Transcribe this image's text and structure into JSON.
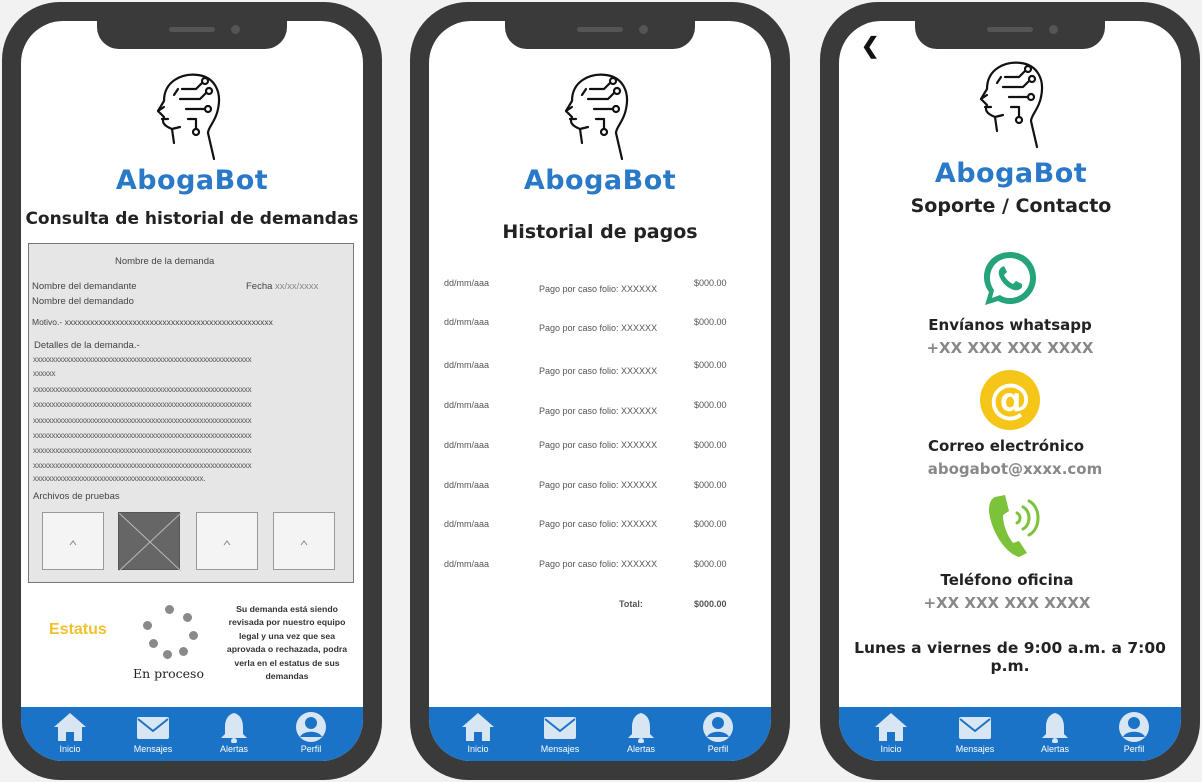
{
  "brand": "AbogaBot",
  "nav": [
    {
      "label": "Inicio",
      "icon": "home-icon"
    },
    {
      "label": "Mensajes",
      "icon": "mail-icon"
    },
    {
      "label": "Alertas",
      "icon": "bell-icon"
    },
    {
      "label": "Perfil",
      "icon": "user-icon"
    }
  ],
  "screen1": {
    "title": "Consulta de historial de demandas",
    "claim_name_label": "Nombre de la demanda",
    "plaintiff_label": "Nombre del demandante",
    "date_label": "Fecha",
    "date_value": "xx/xx/xxxx",
    "defendant_label": "Nombre del demandado",
    "motivo": "Motivo.- xxxxxxxxxxxxxxxxxxxxxxxxxxxxxxxxxxxxxxxxxxxxxxxxx",
    "details_label": "Detalles de la demanda.-",
    "details_lines": [
      "xxxxxxxxxxxxxxxxxxxxxxxxxxxxxxxxxxxxxxxxxxxxxxxxxxxxxxxxxxx",
      "xxxxxx",
      "xxxxxxxxxxxxxxxxxxxxxxxxxxxxxxxxxxxxxxxxxxxxxxxxxxxxxxxxxxx",
      "xxxxxxxxxxxxxxxxxxxxxxxxxxxxxxxxxxxxxxxxxxxxxxxxxxxxxxxxxxx",
      "xxxxxxxxxxxxxxxxxxxxxxxxxxxxxxxxxxxxxxxxxxxxxxxxxxxxxxxxxxx",
      "xxxxxxxxxxxxxxxxxxxxxxxxxxxxxxxxxxxxxxxxxxxxxxxxxxxxxxxxxxx",
      "xxxxxxxxxxxxxxxxxxxxxxxxxxxxxxxxxxxxxxxxxxxxxxxxxxxxxxxxxxx",
      "xxxxxxxxxxxxxxxxxxxxxxxxxxxxxxxxxxxxxxxxxxxxxxxxxxxxxxxxxxx",
      "xxxxxxxxxxxxxxxxxxxxxxxxxxxxxxxxxxxxxxxxxxxxxx."
    ],
    "evidence_label": "Archivos de pruebas",
    "status_label": "Estatus",
    "status_value": "En proceso",
    "status_message": "Su demanda está siendo revisada por nuestro equipo legal y una vez que sea aprovada o rechazada, podra verla en el estatus de sus demandas",
    "status_color": "#f2c12e"
  },
  "screen2": {
    "title": "Historial de pagos",
    "payments": [
      {
        "date": "dd/mm/aaa",
        "concept": "Pago por caso folio: XXXXXX",
        "amount": "$000.00"
      },
      {
        "date": "dd/mm/aaa",
        "concept": "Pago por caso folio: XXXXXX",
        "amount": "$000.00"
      },
      {
        "date": "dd/mm/aaa",
        "concept": "Pago por caso folio: XXXXXX",
        "amount": "$000.00"
      },
      {
        "date": "dd/mm/aaa",
        "concept": "Pago por caso folio: XXXXXX",
        "amount": "$000.00"
      },
      {
        "date": "dd/mm/aaa",
        "concept": "Pago por caso folio: XXXXXX",
        "amount": "$000.00"
      },
      {
        "date": "dd/mm/aaa",
        "concept": "Pago por caso folio: XXXXXX",
        "amount": "$000.00"
      },
      {
        "date": "dd/mm/aaa",
        "concept": "Pago por caso folio: XXXXXX",
        "amount": "$000.00"
      },
      {
        "date": "dd/mm/aaa",
        "concept": "Pago por caso folio: XXXXXX",
        "amount": "$000.00"
      }
    ],
    "total_label": "Total:",
    "total_value": "$000.00"
  },
  "screen3": {
    "title": "Soporte / Contacto",
    "whatsapp_label": "Envíanos whatsapp",
    "whatsapp_value": "+XX XXX XXX XXXX",
    "email_label": "Correo electrónico",
    "email_value": "abogabot@xxxx.com",
    "phone_label": "Teléfono oficina",
    "phone_value": "+XX XXX XXX XXXX",
    "hours": "Lunes a viernes de 9:00 a.m. a 7:00 p.m.",
    "whatsapp_color": "#25a37a",
    "email_color": "#f5c518",
    "phone_color": "#7cc23a"
  }
}
